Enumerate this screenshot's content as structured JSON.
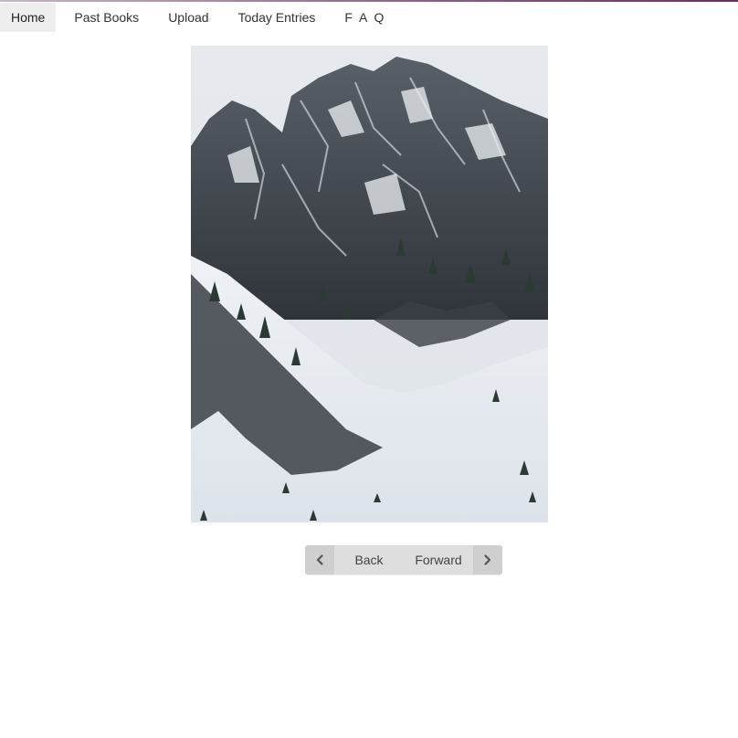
{
  "nav": {
    "items": [
      {
        "label": "Home",
        "active": true
      },
      {
        "label": "Past Books",
        "active": false
      },
      {
        "label": "Upload",
        "active": false
      },
      {
        "label": "Today Entries",
        "active": false
      },
      {
        "label": "F A Q",
        "active": false
      }
    ]
  },
  "photo": {
    "subject": "snow-covered mountain with evergreen trees"
  },
  "pager": {
    "back_label": "Back",
    "forward_label": "Forward",
    "back_icon": "chevron-left-icon",
    "forward_icon": "chevron-right-icon"
  },
  "colors": {
    "nav_active_bg": "#eeeeee",
    "pager_bg": "#dedede",
    "pager_icon_bg": "#cfcfcf"
  }
}
